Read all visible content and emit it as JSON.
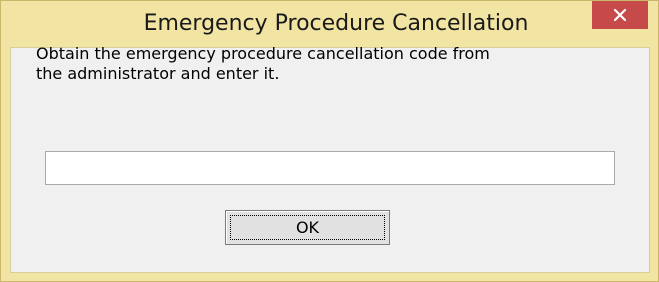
{
  "window": {
    "title": "Emergency Procedure Cancellation",
    "close_icon": "close-x-icon"
  },
  "dialog": {
    "message_line1": "Obtain the emergency procedure cancellation code from",
    "message_line2": "the administrator and enter it.",
    "code_input_value": "",
    "ok_label": "OK"
  },
  "colors": {
    "frame": "#f2e5a3",
    "close_button": "#c74a4a",
    "client_background": "#f0f0f0"
  }
}
